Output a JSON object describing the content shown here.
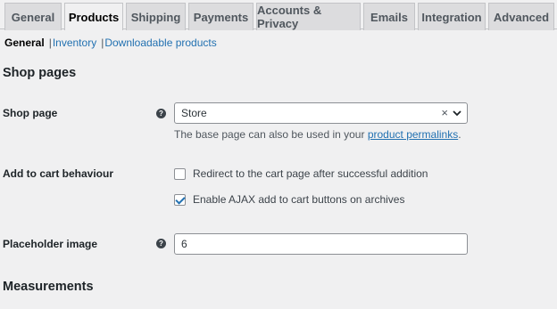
{
  "tabs": [
    {
      "label": "General"
    },
    {
      "label": "Products",
      "active": true
    },
    {
      "label": "Shipping"
    },
    {
      "label": "Payments"
    },
    {
      "label": "Accounts & Privacy"
    },
    {
      "label": "Emails"
    },
    {
      "label": "Integration"
    },
    {
      "label": "Advanced"
    }
  ],
  "subnav": {
    "current": "General",
    "separator": "|",
    "links": [
      "Inventory",
      "Downloadable products"
    ]
  },
  "sections": {
    "shop_pages": "Shop pages",
    "measurements": "Measurements"
  },
  "fields": {
    "shop_page": {
      "label": "Shop page",
      "value": "Store",
      "clear_icon": "×",
      "description_prefix": "The base page can also be used in your ",
      "description_link": "product permalinks",
      "description_suffix": "."
    },
    "add_to_cart": {
      "label": "Add to cart behaviour",
      "options": [
        {
          "label": "Redirect to the cart page after successful addition",
          "checked": false
        },
        {
          "label": "Enable AJAX add to cart buttons on archives",
          "checked": true
        }
      ]
    },
    "placeholder_image": {
      "label": "Placeholder image",
      "value": "6"
    }
  },
  "help_icon": "?",
  "colors": {
    "link": "#2271b1",
    "tab_inactive_bg": "#dcdcde",
    "page_bg": "#f0f0f1"
  }
}
